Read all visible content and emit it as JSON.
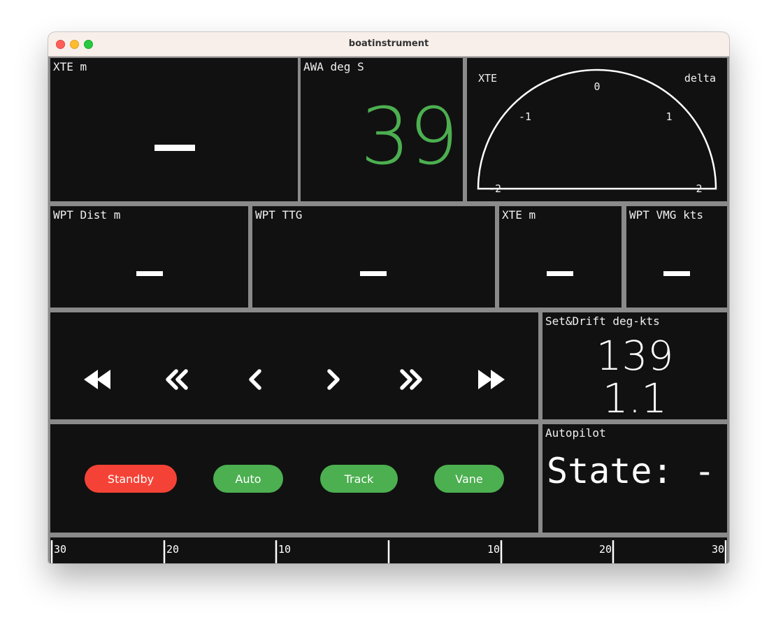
{
  "window": {
    "title": "boatinstrument"
  },
  "colors": {
    "accent_green": "#4caf50",
    "accent_red": "#f44336",
    "panel_bg": "#111111",
    "divider": "#8a8a8a"
  },
  "row1": {
    "xte": {
      "label": "XTE m",
      "value": ""
    },
    "awa": {
      "label": "AWA deg S",
      "value": "39"
    },
    "gauge": {
      "left_label": "XTE",
      "right_label": "delta",
      "ticks": {
        "zero": "0",
        "neg1": "-1",
        "pos1": "1",
        "neg2": "-2",
        "pos2": "2"
      }
    }
  },
  "row2": {
    "wpt_dist": {
      "label": "WPT Dist m",
      "value": ""
    },
    "wpt_ttg": {
      "label": "WPT TTG",
      "value": ""
    },
    "xte": {
      "label": "XTE m",
      "value": ""
    },
    "wpt_vmg": {
      "label": "WPT VMG kts",
      "value": ""
    }
  },
  "row3": {
    "controls": [
      "fast-rewind-icon",
      "double-left-icon",
      "left-icon",
      "right-icon",
      "double-right-icon",
      "fast-forward-icon"
    ],
    "set_drift": {
      "label": "Set&Drift deg-kts",
      "set": "139",
      "drift": "1.1"
    }
  },
  "row4": {
    "buttons": {
      "standby": "Standby",
      "auto": "Auto",
      "track": "Track",
      "vane": "Vane"
    },
    "autopilot": {
      "label": "Autopilot",
      "state": "State: -"
    }
  },
  "scale": {
    "labels": {
      "l30": "30",
      "l20": "20",
      "l10": "10",
      "r10": "10",
      "r20": "20",
      "r30": "30"
    }
  }
}
